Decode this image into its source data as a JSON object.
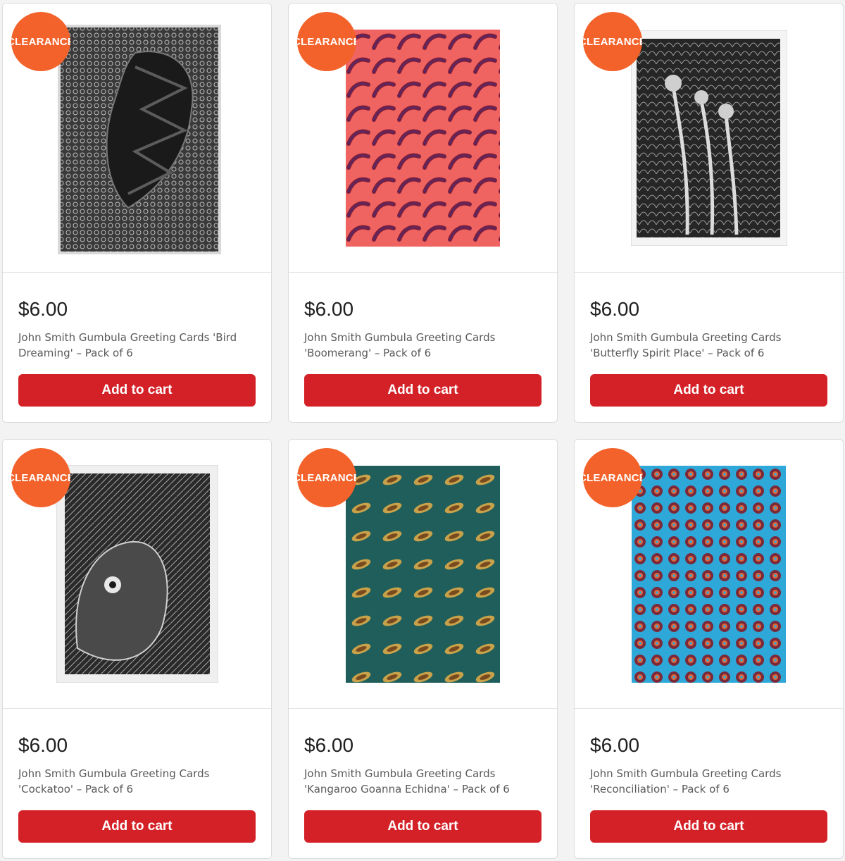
{
  "products": [
    {
      "badge": "CLEARANCE",
      "price": "$6.00",
      "title": "John Smith Gumbula Greeting Cards 'Bird Dreaming' – Pack of 6",
      "cta": "Add to cart",
      "image": "bird-dreaming-artwork",
      "image_colors": [
        "#2b2b2b",
        "#8a8a8a",
        "#d9d9d9"
      ]
    },
    {
      "badge": "CLEARANCE",
      "price": "$6.00",
      "title": "John Smith Gumbula Greeting Cards 'Boomerang' – Pack of 6",
      "cta": "Add to cart",
      "image": "boomerang-artwork",
      "image_colors": [
        "#ef6461",
        "#7a1f3d",
        "#4a2a7a"
      ]
    },
    {
      "badge": "CLEARANCE",
      "price": "$6.00",
      "title": "John Smith Gumbula Greeting Cards 'Butterfly Spirit Place' – Pack of 6",
      "cta": "Add to cart",
      "image": "butterfly-spirit-place-artwork",
      "image_colors": [
        "#1e1e1e",
        "#9a9a9a",
        "#f2f2f2"
      ]
    },
    {
      "badge": "CLEARANCE",
      "price": "$6.00",
      "title": "John Smith Gumbula Greeting Cards 'Cockatoo' – Pack of 6",
      "cta": "Add to cart",
      "image": "cockatoo-artwork",
      "image_colors": [
        "#262626",
        "#8c8c8c",
        "#e8e8e8"
      ]
    },
    {
      "badge": "CLEARANCE",
      "price": "$6.00",
      "title": "John Smith Gumbula Greeting Cards 'Kangaroo Goanna Echidna' – Pack of 6",
      "cta": "Add to cart",
      "image": "kangaroo-goanna-echidna-artwork",
      "image_colors": [
        "#1f5e5a",
        "#c8a24a",
        "#7a4a1f"
      ]
    },
    {
      "badge": "CLEARANCE",
      "price": "$6.00",
      "title": "John Smith Gumbula Greeting Cards 'Reconciliation' – Pack of 6",
      "cta": "Add to cart",
      "image": "reconciliation-artwork",
      "image_colors": [
        "#2ea8d8",
        "#7a2a3a",
        "#e0673a"
      ]
    }
  ]
}
